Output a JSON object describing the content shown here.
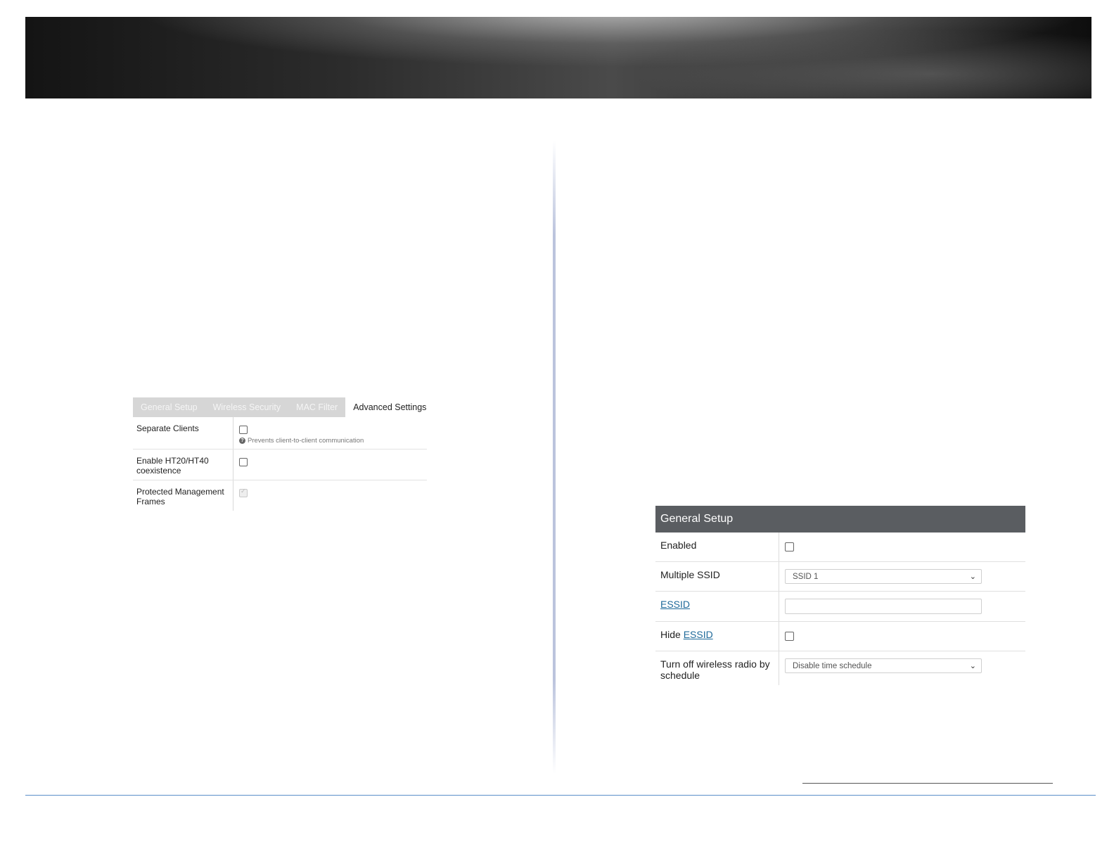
{
  "advanced": {
    "tabs": [
      "General Setup",
      "Wireless Security",
      "MAC Filter",
      "Advanced Settings"
    ],
    "active_tab": "Advanced Settings",
    "rows": {
      "separate_clients": {
        "label": "Separate Clients",
        "checked": false,
        "hint": "Prevents client-to-client communication"
      },
      "ht_coexistence": {
        "label": "Enable HT20/HT40 coexistence",
        "checked": false
      },
      "pmf": {
        "label": "Protected Management Frames",
        "checked": true,
        "disabled": true
      }
    }
  },
  "general": {
    "title": "General Setup",
    "enabled_label": "Enabled",
    "multiple_ssid_label": "Multiple SSID",
    "multiple_ssid_value": "SSID 1",
    "essid_label": "ESSID",
    "essid_value": "",
    "hide_label": "Hide",
    "hide_link": "ESSID",
    "schedule_label": "Turn off wireless radio by schedule",
    "schedule_value": "Disable time schedule"
  },
  "colors": {
    "header_bg": "#5a5d61",
    "link": "#1f6a9a",
    "footer_rule": "#5b8ec9"
  }
}
